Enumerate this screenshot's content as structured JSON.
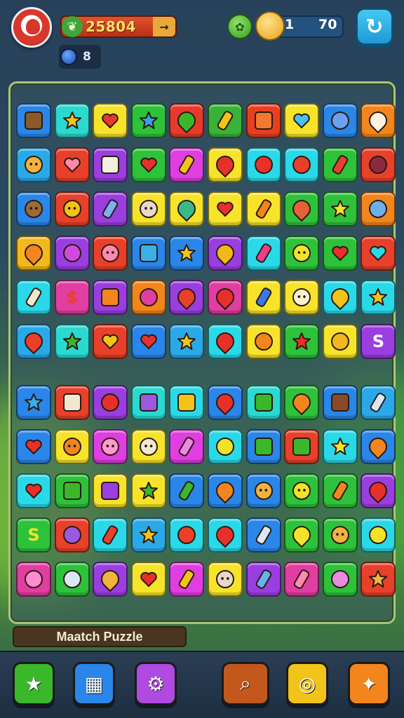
{
  "header": {
    "score": "25804",
    "score_arrow": "→",
    "gems": "8",
    "coins_left": "1",
    "coins_right": "70",
    "refresh_icon": "↻"
  },
  "game_title": "Maatch Puzzle",
  "board": {
    "top_rows": [
      [
        {
          "c": "#2a86e8",
          "i": "tag",
          "g": "#8a5a2a"
        },
        {
          "c": "#2ad9d0",
          "i": "star",
          "g": "#f2c419"
        },
        {
          "c": "#f7e329",
          "i": "heart",
          "g": "#e83a2a"
        },
        {
          "c": "#2ec23b",
          "i": "star",
          "g": "#3aa0e8"
        },
        {
          "c": "#e83a2a",
          "i": "drop",
          "g": "#3ab82a"
        },
        {
          "c": "#39b23a",
          "i": "bar",
          "g": "#f2c419"
        },
        {
          "c": "#e8401f",
          "i": "sq",
          "g": "#f27a30"
        },
        {
          "c": "#f7e329",
          "i": "heart",
          "g": "#46c3f0"
        },
        {
          "c": "#2a86e8",
          "i": "round",
          "g": "#6aa2ef"
        },
        {
          "c": "#f2851c",
          "i": "drop",
          "g": "#fff3e0"
        }
      ],
      [
        {
          "c": "#2aa9e8",
          "i": "face",
          "g": "#f2b240"
        },
        {
          "c": "#e8402a",
          "i": "heart",
          "g": "#ff8aa8"
        },
        {
          "c": "#9a3ee0",
          "i": "sq",
          "g": "#f2efe0"
        },
        {
          "c": "#2ec23b",
          "i": "heart",
          "g": "#e8302a"
        },
        {
          "c": "#e03ee0",
          "i": "bar",
          "g": "#f2c419"
        },
        {
          "c": "#f7e329",
          "i": "drop",
          "g": "#e8302a"
        },
        {
          "c": "#2ad9e8",
          "i": "round",
          "g": "#e8302a"
        },
        {
          "c": "#2ad9e8",
          "i": "round",
          "g": "#e8402a"
        },
        {
          "c": "#2ec23b",
          "i": "bar",
          "g": "#e8402a"
        },
        {
          "c": "#e8402a",
          "i": "round",
          "g": "#8a2a40"
        }
      ],
      [
        {
          "c": "#2a86e8",
          "i": "face",
          "g": "#9a6a3a"
        },
        {
          "c": "#e8402a",
          "i": "face",
          "g": "#f2c419"
        },
        {
          "c": "#9a3ee0",
          "i": "bar",
          "g": "#7ab0f0"
        },
        {
          "c": "#f7e329",
          "i": "face",
          "g": "#e8d8c8"
        },
        {
          "c": "#f7e329",
          "i": "drop",
          "g": "#3ab88a"
        },
        {
          "c": "#f7e329",
          "i": "heart",
          "g": "#e8302a"
        },
        {
          "c": "#f7e329",
          "i": "bar",
          "g": "#f2851c"
        },
        {
          "c": "#2ec23b",
          "i": "drop",
          "g": "#e8603a"
        },
        {
          "c": "#2ec23b",
          "i": "star",
          "g": "#f2e329"
        },
        {
          "c": "#f2851c",
          "i": "round",
          "g": "#6ab0ef"
        }
      ],
      [
        {
          "c": "#f2b81c",
          "i": "drop",
          "g": "#f2851c"
        },
        {
          "c": "#9a3ee0",
          "i": "round",
          "g": "#d04ae0"
        },
        {
          "c": "#e8402a",
          "i": "face",
          "g": "#ff8ab0"
        },
        {
          "c": "#2a86e8",
          "i": "sq",
          "g": "#3ab0e8"
        },
        {
          "c": "#2a86e8",
          "i": "star",
          "g": "#f2c419"
        },
        {
          "c": "#9a3ee0",
          "i": "drop",
          "g": "#f2b81c"
        },
        {
          "c": "#2ad9e8",
          "i": "bar",
          "g": "#e8408a"
        },
        {
          "c": "#2ec23b",
          "i": "face",
          "g": "#f2e329"
        },
        {
          "c": "#2ec23b",
          "i": "heart",
          "g": "#e8302a"
        },
        {
          "c": "#e8402a",
          "i": "heart",
          "g": "#2ad9e8"
        }
      ],
      [
        {
          "c": "#2ad9e8",
          "i": "bar",
          "g": "#f2e8d0"
        },
        {
          "c": "#e03ea0",
          "i": "text",
          "g": "#e8402a",
          "t": "$"
        },
        {
          "c": "#9a3ee0",
          "i": "sq",
          "g": "#f2851c"
        },
        {
          "c": "#f2851c",
          "i": "round",
          "g": "#e03ea0"
        },
        {
          "c": "#9a3ee0",
          "i": "drop",
          "g": "#e8402a"
        },
        {
          "c": "#e03ea0",
          "i": "drop",
          "g": "#e8302a"
        },
        {
          "c": "#f7e329",
          "i": "bar",
          "g": "#3a7ae8"
        },
        {
          "c": "#f7e329",
          "i": "face",
          "g": "#fff0d0"
        },
        {
          "c": "#2ad9e8",
          "i": "drop",
          "g": "#f2c419"
        },
        {
          "c": "#2ad9e8",
          "i": "star",
          "g": "#f2c419"
        }
      ],
      [
        {
          "c": "#2aa9e8",
          "i": "drop",
          "g": "#e8402a"
        },
        {
          "c": "#2ad9d0",
          "i": "star",
          "g": "#3ab82a"
        },
        {
          "c": "#e8402a",
          "i": "heart",
          "g": "#f2c419"
        },
        {
          "c": "#2a86e8",
          "i": "heart",
          "g": "#e8302a"
        },
        {
          "c": "#2aa9e8",
          "i": "star",
          "g": "#f2c419"
        },
        {
          "c": "#2ad9e8",
          "i": "drop",
          "g": "#e8302a"
        },
        {
          "c": "#f7e329",
          "i": "round",
          "g": "#f2851c"
        },
        {
          "c": "#2ec23b",
          "i": "star",
          "g": "#e8302a"
        },
        {
          "c": "#f7e329",
          "i": "round",
          "g": "#f2b81c"
        },
        {
          "c": "#9a3ee0",
          "i": "text",
          "g": "#ffffff",
          "t": "S"
        }
      ]
    ],
    "bottom_rows": [
      [
        {
          "c": "#2a86e8",
          "i": "star",
          "g": "#3ab0e8"
        },
        {
          "c": "#e8402a",
          "i": "sq",
          "g": "#f2e8d0"
        },
        {
          "c": "#9a3ee0",
          "i": "round",
          "g": "#e8302a"
        },
        {
          "c": "#2ad9d0",
          "i": "sq",
          "g": "#9a5ae0"
        },
        {
          "c": "#2ad9e8",
          "i": "sq",
          "g": "#f2c419"
        },
        {
          "c": "#2a86e8",
          "i": "drop",
          "g": "#e8302a"
        },
        {
          "c": "#2ad9d0",
          "i": "sq",
          "g": "#3ab82a"
        },
        {
          "c": "#2ec23b",
          "i": "drop",
          "g": "#f2851c"
        },
        {
          "c": "#2a86e8",
          "i": "sq",
          "g": "#8a4a2a"
        },
        {
          "c": "#2aa9e8",
          "i": "bar",
          "g": "#dbe8f2"
        }
      ],
      [
        {
          "c": "#2a86e8",
          "i": "heart",
          "g": "#e8302a"
        },
        {
          "c": "#f7e329",
          "i": "face",
          "g": "#f2851c"
        },
        {
          "c": "#e03ee0",
          "i": "face",
          "g": "#ff9ad0"
        },
        {
          "c": "#f7e329",
          "i": "face",
          "g": "#f2e8d0"
        },
        {
          "c": "#e03ee0",
          "i": "bar",
          "g": "#e88ae0"
        },
        {
          "c": "#2ad9e8",
          "i": "round",
          "g": "#f2e329"
        },
        {
          "c": "#2a86e8",
          "i": "sq",
          "g": "#3ab82a"
        },
        {
          "c": "#e8402a",
          "i": "sq",
          "g": "#3ab82a"
        },
        {
          "c": "#2ad9e8",
          "i": "star",
          "g": "#f2e329"
        },
        {
          "c": "#2a86e8",
          "i": "drop",
          "g": "#f2851c"
        }
      ],
      [
        {
          "c": "#2ad9e8",
          "i": "heart",
          "g": "#e8302a"
        },
        {
          "c": "#2ec23b",
          "i": "sq",
          "g": "#3ab82a"
        },
        {
          "c": "#f7e329",
          "i": "sq",
          "g": "#9a3ee0"
        },
        {
          "c": "#f7e329",
          "i": "star",
          "g": "#3ab82a"
        },
        {
          "c": "#2a86e8",
          "i": "bar",
          "g": "#3ab82a"
        },
        {
          "c": "#2a86e8",
          "i": "drop",
          "g": "#f2851c"
        },
        {
          "c": "#2a86e8",
          "i": "face",
          "g": "#f2b240"
        },
        {
          "c": "#2ec23b",
          "i": "face",
          "g": "#f2e329"
        },
        {
          "c": "#2ec23b",
          "i": "bar",
          "g": "#f2851c"
        },
        {
          "c": "#9a3ee0",
          "i": "drop",
          "g": "#e8302a"
        }
      ],
      [
        {
          "c": "#2ec23b",
          "i": "text",
          "g": "#f2e329",
          "t": "S"
        },
        {
          "c": "#e8402a",
          "i": "round",
          "g": "#9a5ae0"
        },
        {
          "c": "#2ad9e8",
          "i": "bar",
          "g": "#e8402a"
        },
        {
          "c": "#2aa9e8",
          "i": "star",
          "g": "#f2c419"
        },
        {
          "c": "#2ad9e8",
          "i": "round",
          "g": "#e8402a"
        },
        {
          "c": "#2ad9e8",
          "i": "drop",
          "g": "#e8302a"
        },
        {
          "c": "#2a86e8",
          "i": "bar",
          "g": "#dbe8f2"
        },
        {
          "c": "#2ec23b",
          "i": "drop",
          "g": "#f2e329"
        },
        {
          "c": "#2ec23b",
          "i": "face",
          "g": "#f2b240"
        },
        {
          "c": "#2ad9e8",
          "i": "round",
          "g": "#f2e329"
        }
      ],
      [
        {
          "c": "#e03ea0",
          "i": "round",
          "g": "#ff8ad0"
        },
        {
          "c": "#2ec23b",
          "i": "round",
          "g": "#dbe8f2"
        },
        {
          "c": "#9a3ee0",
          "i": "drop",
          "g": "#f2b240"
        },
        {
          "c": "#f7e329",
          "i": "heart",
          "g": "#e8302a"
        },
        {
          "c": "#e03ee0",
          "i": "bar",
          "g": "#f2c419"
        },
        {
          "c": "#f7e329",
          "i": "face",
          "g": "#e8d8c8"
        },
        {
          "c": "#9a3ee0",
          "i": "bar",
          "g": "#6ab0ef"
        },
        {
          "c": "#e03ea0",
          "i": "bar",
          "g": "#ff8ab0"
        },
        {
          "c": "#2ec23b",
          "i": "round",
          "g": "#e88ae0"
        },
        {
          "c": "#e8402a",
          "i": "star",
          "g": "#f2b240"
        }
      ]
    ]
  },
  "bottom_buttons": [
    {
      "name": "star-button",
      "color": "#3ab82a",
      "glyph": "★"
    },
    {
      "name": "grid-button",
      "color": "#2a86e8",
      "glyph": "▦"
    },
    {
      "name": "settings-button",
      "color": "#b04ae0",
      "glyph": "⚙"
    },
    {
      "name": "search-button",
      "color": "#c2581c",
      "glyph": "⌕"
    },
    {
      "name": "target-button",
      "color": "#f2c419",
      "glyph": "◎"
    },
    {
      "name": "bonus-button",
      "color": "#f2851c",
      "glyph": "✦"
    }
  ]
}
